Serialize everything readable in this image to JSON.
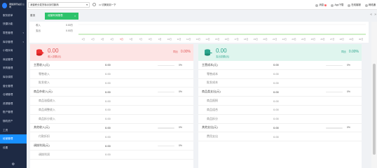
{
  "sidebar": {
    "logo_text": "网络通讯站点 公司",
    "items": [
      {
        "label": "服务菜单",
        "caret": ""
      },
      {
        "label": "快捷功能",
        "caret": ""
      },
      {
        "label": "零售管理",
        "caret": "▾"
      },
      {
        "label": "库存管理",
        "caret": "▾"
      },
      {
        "label": "小程序商",
        "caret": ""
      },
      {
        "label": "商品管理",
        "caret": ""
      },
      {
        "label": "采购管理",
        "caret": ""
      },
      {
        "label": "库存调拨",
        "caret": ""
      },
      {
        "label": "营业管理",
        "caret": ""
      },
      {
        "label": "仓储管理",
        "caret": ""
      },
      {
        "label": "资源管理",
        "caret": ""
      },
      {
        "label": "账户管理",
        "caret": ""
      },
      {
        "label": "随机资产",
        "caret": ""
      },
      {
        "label": "工资",
        "caret": ""
      },
      {
        "label": "经营管理",
        "caret": "",
        "active": true
      },
      {
        "label": "设置",
        "caret": ""
      }
    ],
    "footer_icon": "gear-icon"
  },
  "topbar": {
    "org_select": "消费积分发货标示到付款商",
    "org_caret": "▾",
    "settings_icon": "gear-icon",
    "switch_label": "切换到另一下",
    "message_label": "消息",
    "message_badge": "3",
    "app_label": "App下载",
    "service_label": "在线客服",
    "user_label": "网络通"
  },
  "tabs": {
    "home_label": "首页",
    "active_label": "经营利润报表",
    "close_glyph": "×",
    "nav_prev": "«",
    "nav_next": "»"
  },
  "chart": {
    "income_label": "收入",
    "income_value": "0.00万",
    "expense_label": "支出",
    "expense_value": "0.00万",
    "x_ticks": [
      "1日",
      "2日",
      "3日",
      "4日",
      "5日",
      "6日",
      "7日",
      "8日",
      "9日",
      "10日",
      "11日",
      "12日",
      "13日",
      "14日",
      "15日",
      "16日",
      "17日",
      "18日",
      "19日",
      "20日",
      "21日",
      "22日",
      "23日",
      "24日",
      "25日",
      "26日",
      "27日",
      "28日",
      "29日",
      "30日"
    ]
  },
  "income_panel": {
    "amount": "0.00",
    "subtitle": "收入总额(元)",
    "ratio_label": "同比",
    "ratio_value": "0.00%",
    "rows": [
      {
        "label": "主营收入(元)",
        "amount": "0.00",
        "pct": "0%",
        "sub": false,
        "bar": 0
      },
      {
        "label": "零售收入",
        "amount": "0.00",
        "pct": "",
        "sub": true,
        "bar": null
      },
      {
        "label": "批发收入",
        "amount": "0.00",
        "pct": "",
        "sub": true,
        "bar": null
      },
      {
        "label": "商品杂收入(元)",
        "amount": "0.00",
        "pct": "0%",
        "sub": false,
        "bar": 0
      },
      {
        "label": "商品溢值收入",
        "amount": "0.00",
        "pct": "",
        "sub": true,
        "bar": null
      },
      {
        "label": "商品调整收入",
        "amount": "0.00",
        "pct": "",
        "sub": true,
        "bar": null
      },
      {
        "label": "商品拆分收入",
        "amount": "0.00",
        "pct": "",
        "sub": true,
        "bar": null
      },
      {
        "label": "其他收入(元)",
        "amount": "0.00",
        "pct": "0%",
        "sub": false,
        "bar": 0
      },
      {
        "label": "付款折扣",
        "amount": "0.00",
        "pct": "",
        "sub": true,
        "bar": null
      },
      {
        "label": "调拨利润(元)",
        "amount": "0.00",
        "pct": "0%",
        "sub": false,
        "bar": 0
      },
      {
        "label": "调拨利润",
        "amount": "0.00",
        "pct": "",
        "sub": true,
        "bar": null
      }
    ]
  },
  "expense_panel": {
    "amount": "0.00",
    "subtitle": "支出总额(元)",
    "ratio_label": "同比",
    "ratio_value": "0.00%",
    "rows": [
      {
        "label": "主营成本(元)",
        "amount": "0.00",
        "pct": "0%",
        "sub": false,
        "bar": 0
      },
      {
        "label": "零售成本",
        "amount": "0.00",
        "pct": "",
        "sub": true,
        "bar": null
      },
      {
        "label": "批发成本",
        "amount": "0.00",
        "pct": "",
        "sub": true,
        "bar": null
      },
      {
        "label": "商品类支出(元)",
        "amount": "0.00",
        "pct": "0%",
        "sub": false,
        "bar": 0
      },
      {
        "label": "商品报损",
        "amount": "0.00",
        "pct": "",
        "sub": true,
        "bar": null
      },
      {
        "label": "商品组合",
        "amount": "0.00",
        "pct": "",
        "sub": true,
        "bar": null
      },
      {
        "label": "商品拆分",
        "amount": "0.00",
        "pct": "",
        "sub": true,
        "bar": null
      },
      {
        "label": "其他支出(元)",
        "amount": "0.00",
        "pct": "0%",
        "sub": false,
        "bar": 0
      },
      {
        "label": "费用支出",
        "amount": "0.00",
        "pct": "",
        "sub": true,
        "bar": null
      }
    ]
  },
  "colors": {
    "sidebar_bg": "#1e2a44",
    "accent": "#1890ff",
    "tab_active": "#2dc26b",
    "income_head": "#fde4e4",
    "expense_head": "#dff5ee",
    "line": "#7fd36a"
  }
}
